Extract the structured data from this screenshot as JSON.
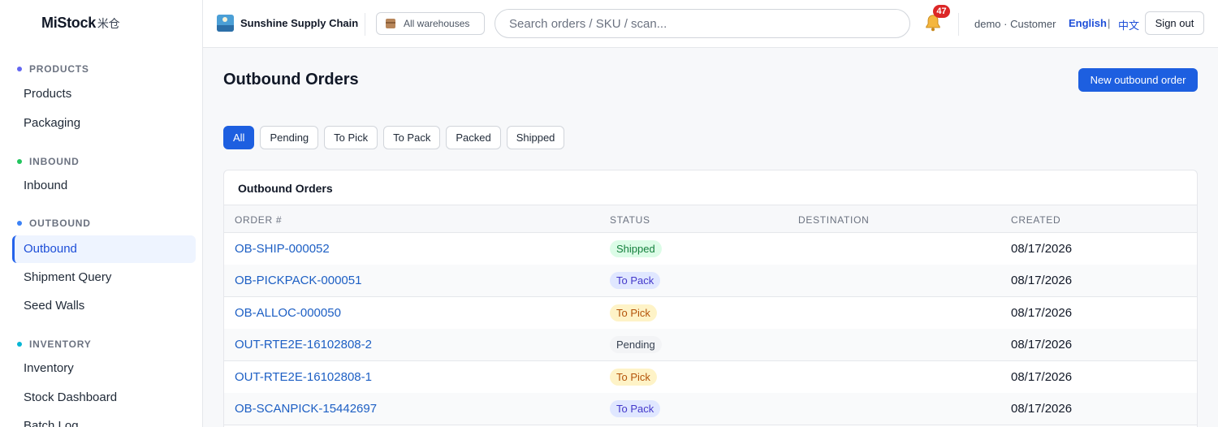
{
  "brand": {
    "name": "MiStock",
    "name_cn": "米仓"
  },
  "sidebar": {
    "sections": [
      {
        "label": "PRODUCTS",
        "color": "#6366f1"
      },
      {
        "label": "INBOUND",
        "color": "#22c55e"
      },
      {
        "label": "OUTBOUND",
        "color": "#3b82f6"
      },
      {
        "label": "INVENTORY",
        "color": "#06b6d4"
      }
    ],
    "items": [
      {
        "label": "Products"
      },
      {
        "label": "Packaging"
      },
      {
        "label": "Inbound"
      },
      {
        "label": "Outbound",
        "active": true
      },
      {
        "label": "Shipment Query"
      },
      {
        "label": "Seed Walls"
      },
      {
        "label": "Inventory"
      },
      {
        "label": "Stock Dashboard"
      },
      {
        "label": "Batch Log"
      }
    ]
  },
  "header": {
    "org_name": "Sunshine Supply Chain",
    "warehouse_label": "All warehouses",
    "search_placeholder": "Search orders / SKU / scan...",
    "notification_count": "47",
    "user": "demo · Customer",
    "lang_en": "English",
    "lang_sep": "|",
    "lang_zh": "中文",
    "sign_out": "Sign out"
  },
  "main": {
    "title": "Outbound Orders",
    "new_button": "New outbound order",
    "filters": [
      {
        "label": "All",
        "active": true
      },
      {
        "label": "Pending"
      },
      {
        "label": "To Pick"
      },
      {
        "label": "To Pack"
      },
      {
        "label": "Packed"
      },
      {
        "label": "Shipped"
      }
    ]
  },
  "table": {
    "title": "Outbound Orders",
    "columns": [
      "ORDER #",
      "STATUS",
      "DESTINATION",
      "CREATED"
    ],
    "rows": [
      {
        "order": "OB-SHIP-000052",
        "status": "Shipped",
        "destination": "",
        "created": "08/17/2026"
      },
      {
        "order": "OB-PICKPACK-000051",
        "status": "To Pack",
        "destination": "",
        "created": "08/17/2026"
      },
      {
        "order": "OB-ALLOC-000050",
        "status": "To Pick",
        "destination": "",
        "created": "08/17/2026"
      },
      {
        "order": "OUT-RTE2E-16102808-2",
        "status": "Pending",
        "destination": "",
        "created": "08/17/2026"
      },
      {
        "order": "OUT-RTE2E-16102808-1",
        "status": "To Pick",
        "destination": "",
        "created": "08/17/2026"
      },
      {
        "order": "OB-SCANPICK-15442697",
        "status": "To Pack",
        "destination": "",
        "created": "08/17/2026"
      }
    ]
  },
  "colors": {
    "primary": "#1d5fe0",
    "link": "#1d5fc4",
    "badge": "#dc2626"
  }
}
